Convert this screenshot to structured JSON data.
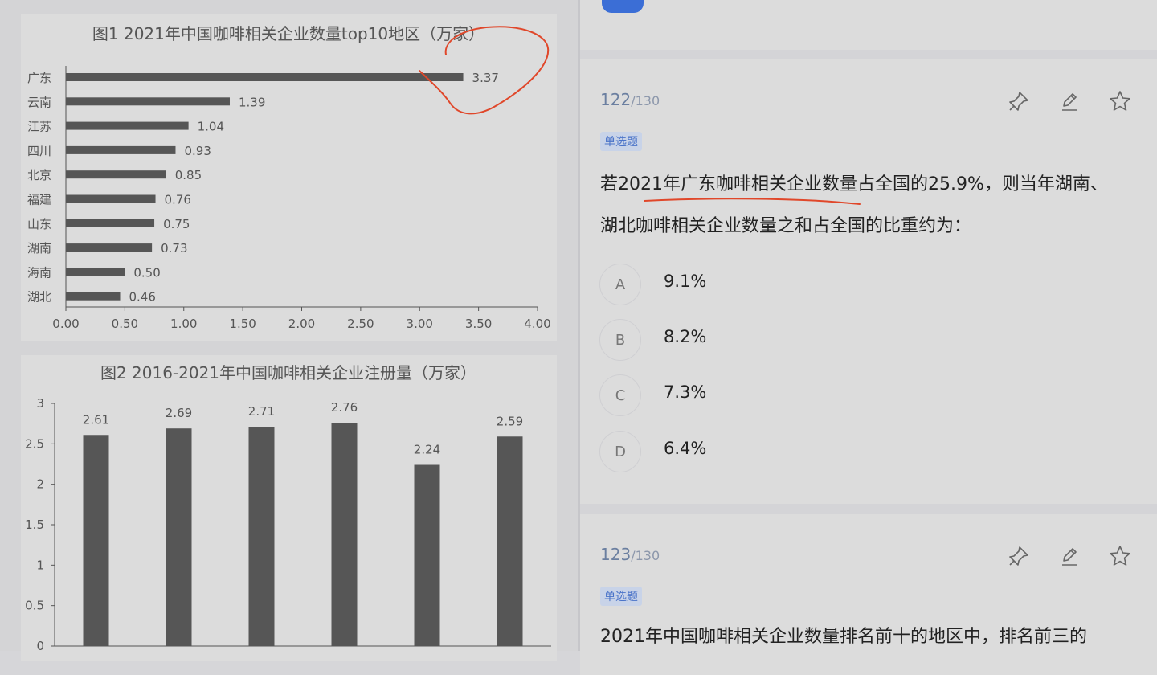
{
  "chart_data": [
    {
      "type": "bar",
      "orientation": "horizontal",
      "title": "图1 2021年中国咖啡相关企业数量top10地区（万家）",
      "categories": [
        "广东",
        "云南",
        "江苏",
        "四川",
        "北京",
        "福建",
        "山东",
        "湖南",
        "海南",
        "湖北"
      ],
      "values": [
        3.37,
        1.39,
        1.04,
        0.93,
        0.85,
        0.76,
        0.75,
        0.73,
        0.5,
        0.46
      ],
      "value_labels": [
        "3.37",
        "1.39",
        "1.04",
        "0.93",
        "0.85",
        "0.76",
        "0.75",
        "0.73",
        "0.50",
        "0.46"
      ],
      "xlim": [
        0,
        4
      ],
      "xticks": [
        "0.00",
        "0.50",
        "1.00",
        "1.50",
        "2.00",
        "2.50",
        "3.00",
        "3.50",
        "4.00"
      ],
      "grid": false,
      "bar_color": "#565656"
    },
    {
      "type": "bar",
      "title": "图2 2016-2021年中国咖啡相关企业注册量（万家）",
      "values": [
        2.61,
        2.69,
        2.71,
        2.76,
        2.24,
        2.59
      ],
      "value_labels": [
        "2.61",
        "2.69",
        "2.71",
        "2.76",
        "2.24",
        "2.59"
      ],
      "ylim": [
        0,
        3
      ],
      "yticks": [
        "0",
        "0.5",
        "1",
        "1.5",
        "2",
        "2.5",
        "3"
      ],
      "grid": false,
      "bar_color": "#565656"
    }
  ],
  "questions": [
    {
      "number": "122",
      "total": "/130",
      "tag": "单选题",
      "stem": "若2021年广东咖啡相关企业数量占全国的25.9%，则当年湖南、湖北咖啡相关企业数量之和占全国的比重约为：",
      "options": [
        {
          "letter": "A",
          "text": "9.1%"
        },
        {
          "letter": "B",
          "text": "8.2%"
        },
        {
          "letter": "C",
          "text": "7.3%"
        },
        {
          "letter": "D",
          "text": "6.4%"
        }
      ]
    },
    {
      "number": "123",
      "total": "/130",
      "tag": "单选题",
      "stem": "2021年中国咖啡相关企业数量排名前十的地区中，排名前三的"
    }
  ],
  "icons": [
    "pin-icon",
    "edit-icon",
    "star-icon"
  ],
  "colors": {
    "accent": "#3b6ed6",
    "annotation": "#e0472a"
  }
}
